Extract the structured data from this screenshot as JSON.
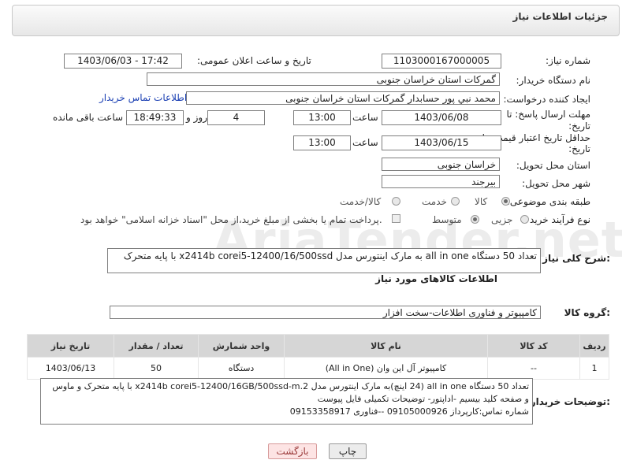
{
  "header": {
    "title": "جزئیات اطلاعات نیاز"
  },
  "watermark": "AriaTender.net",
  "fields": {
    "need_number": {
      "label": "شماره نیاز:",
      "value": "1103000167000005"
    },
    "announce_datetime": {
      "label": "تاریخ و ساعت اعلان عمومی:",
      "value": "1403/06/03 - 17:42"
    },
    "buyer_org": {
      "label": "نام دستگاه خریدار:",
      "value": "گمرکات استان خراسان جنوبی"
    },
    "requester": {
      "label": "ایجاد کننده درخواست:",
      "value": "محمد نبي پور حسابدار گمرکات استان خراسان جنوبی",
      "contact_link": "اطلاعات تماس خریدار"
    },
    "reply_deadline": {
      "label_1": "مهلت ارسال پاسخ: تا",
      "label_2": "تاریخ:",
      "date": "1403/06/08",
      "time_label": "ساعت",
      "time": "13:00",
      "days": "4",
      "days_label": "روز و",
      "remaining": "18:49:33",
      "remaining_label": "ساعت باقی مانده"
    },
    "price_validity": {
      "label_1": "حداقل تاریخ اعتبار قیمت: تا",
      "label_2": "تاریخ:",
      "date": "1403/06/15",
      "time_label": "ساعت",
      "time": "13:00"
    },
    "delivery_province": {
      "label": "استان محل تحویل:",
      "value": "خراسان جنوبی"
    },
    "delivery_city": {
      "label": "شهر محل تحویل:",
      "value": "بیرجند"
    },
    "category": {
      "label": "طبقه بندی موضوعی:",
      "options": [
        "کالا",
        "خدمت",
        "کالا/خدمت"
      ]
    },
    "purchase_type": {
      "label": "نوع فرآیند خرید :",
      "options": [
        "جزیی",
        "متوسط"
      ],
      "note": "پرداخت تمام یا بخشی از مبلغ خرید،از محل \"اسناد خزانه اسلامی\" خواهد بود."
    }
  },
  "description": {
    "label": "شرح کلی نیاز:",
    "value": "تعداد 50 دستگاه all in one به مارک اینتورس مدل x2414b corei5-12400/16/500ssd با پایه متحرک"
  },
  "goods_info": {
    "title": "اطلاعات کالاهای مورد نیاز"
  },
  "goods_group": {
    "label": "گروه کالا:",
    "value": "کامپیوتر و فناوری اطلاعات-سخت افزار"
  },
  "table": {
    "headers": [
      "ردیف",
      "کد کالا",
      "نام کالا",
      "واحد شمارش",
      "تعداد / مقدار",
      "تاریخ نیاز"
    ],
    "rows": [
      [
        "1",
        "--",
        "کامپیوتر آل این وان (All in One)",
        "دستگاه",
        "50",
        "1403/06/13"
      ]
    ]
  },
  "buyer_notes": {
    "label": "توضیحات خریدار:",
    "lines": [
      "تعداد 50 دستگاه all in one (24 اینچ)به مارک اینتورس مدل x2414b corei5-12400/16GB/500ssd-m.2 با پایه متحرک و ماوس",
      "و صفحه کلید بیسیم -اداپتور- توضیحات تکمیلی فایل پیوست",
      "شماره تماس:کارپرداز 09105000926 --فناوری 09153358917"
    ]
  },
  "buttons": {
    "back": "بازگشت",
    "print": "چاپ"
  }
}
